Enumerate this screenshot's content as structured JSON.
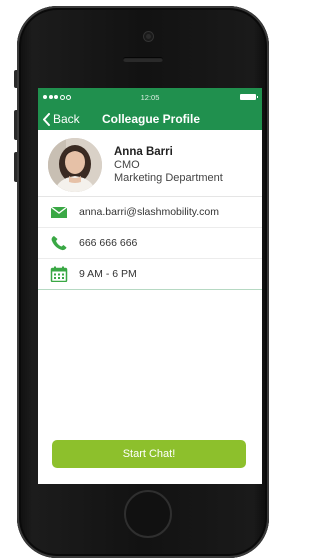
{
  "status_bar": {
    "time": "12:05"
  },
  "nav": {
    "back_label": "Back",
    "title": "Colleague Profile"
  },
  "profile": {
    "name": "Anna Barri",
    "role": "CMO",
    "department": "Marketing Department"
  },
  "contacts": {
    "email": "anna.barri@slashmobility.com",
    "phone": "666 666 666",
    "hours": "9 AM - 6 PM"
  },
  "actions": {
    "start_chat_label": "Start Chat!"
  },
  "colors": {
    "brand_green": "#20904e",
    "accent_lime": "#8dc02c",
    "icon_green": "#3aa845"
  },
  "icons": [
    "envelope-icon",
    "phone-icon",
    "calendar-icon",
    "chevron-left-icon"
  ]
}
